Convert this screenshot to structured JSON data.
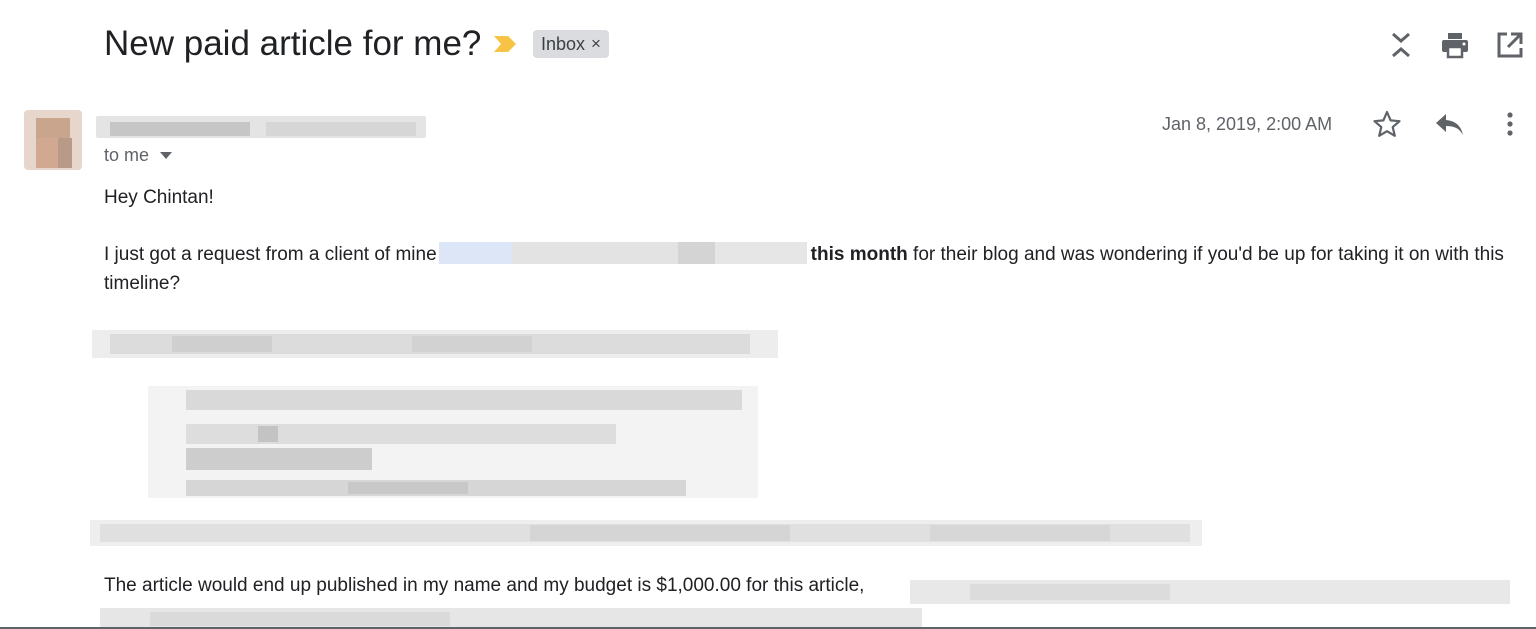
{
  "thread": {
    "subject": "New paid article for me?",
    "label": "Inbox",
    "label_remove": "×"
  },
  "toolbar": {
    "icons": [
      "collapse-all-icon",
      "print-icon",
      "open-in-new-window-icon"
    ]
  },
  "message": {
    "recipient": "to me",
    "date": "Jan 8, 2019, 2:00 AM",
    "icons": [
      "star-icon",
      "reply-icon",
      "more-options-icon"
    ],
    "greeting": "Hey Chintan!",
    "para2_start": "I just got a request from a client of mine",
    "para2_bold": "this month",
    "para2_end": " for their blog and was wondering if you'd be up for taking it on with this timeline?",
    "para3": "The article would end up published in my name and my budget is $1,000.00 for this  article,"
  },
  "colors": {
    "importance_marker": "#f6c344",
    "label_chip_bg": "#dadce0",
    "secondary_text": "#5f6368"
  }
}
